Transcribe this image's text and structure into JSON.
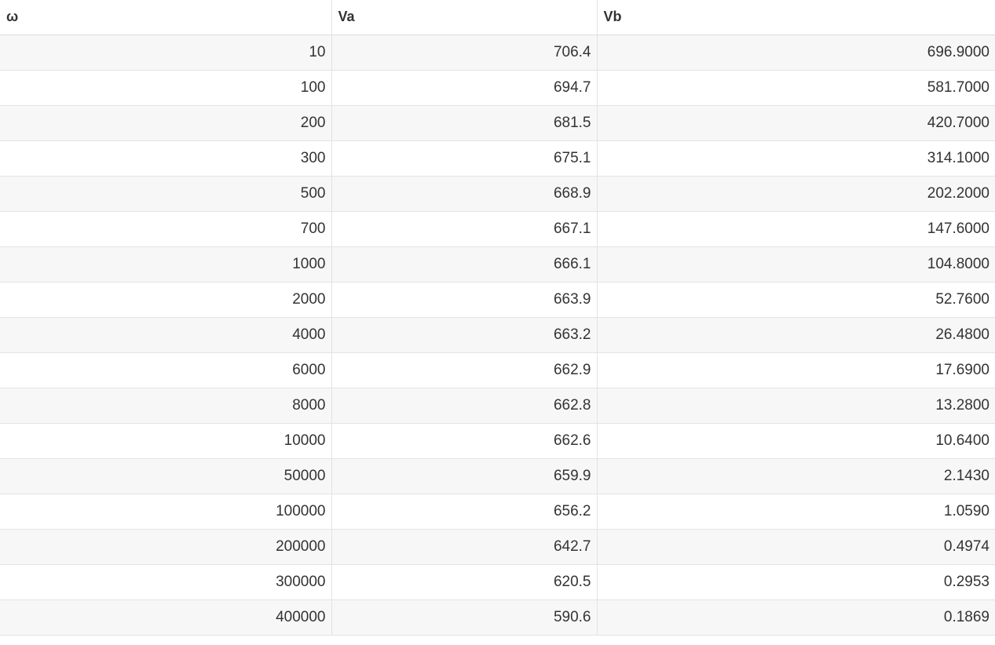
{
  "table": {
    "headers": [
      "ω",
      "Va",
      "Vb"
    ],
    "rows": [
      [
        "10",
        "706.4",
        "696.9000"
      ],
      [
        "100",
        "694.7",
        "581.7000"
      ],
      [
        "200",
        "681.5",
        "420.7000"
      ],
      [
        "300",
        "675.1",
        "314.1000"
      ],
      [
        "500",
        "668.9",
        "202.2000"
      ],
      [
        "700",
        "667.1",
        "147.6000"
      ],
      [
        "1000",
        "666.1",
        "104.8000"
      ],
      [
        "2000",
        "663.9",
        "52.7600"
      ],
      [
        "4000",
        "663.2",
        "26.4800"
      ],
      [
        "6000",
        "662.9",
        "17.6900"
      ],
      [
        "8000",
        "662.8",
        "13.2800"
      ],
      [
        "10000",
        "662.6",
        "10.6400"
      ],
      [
        "50000",
        "659.9",
        "2.1430"
      ],
      [
        "100000",
        "656.2",
        "1.0590"
      ],
      [
        "200000",
        "642.7",
        "0.4974"
      ],
      [
        "300000",
        "620.5",
        "0.2953"
      ],
      [
        "400000",
        "590.6",
        "0.1869"
      ]
    ]
  },
  "colors": {
    "text": "#333333",
    "stripe": "#f7f7f7",
    "border": "#e3e3e3"
  }
}
